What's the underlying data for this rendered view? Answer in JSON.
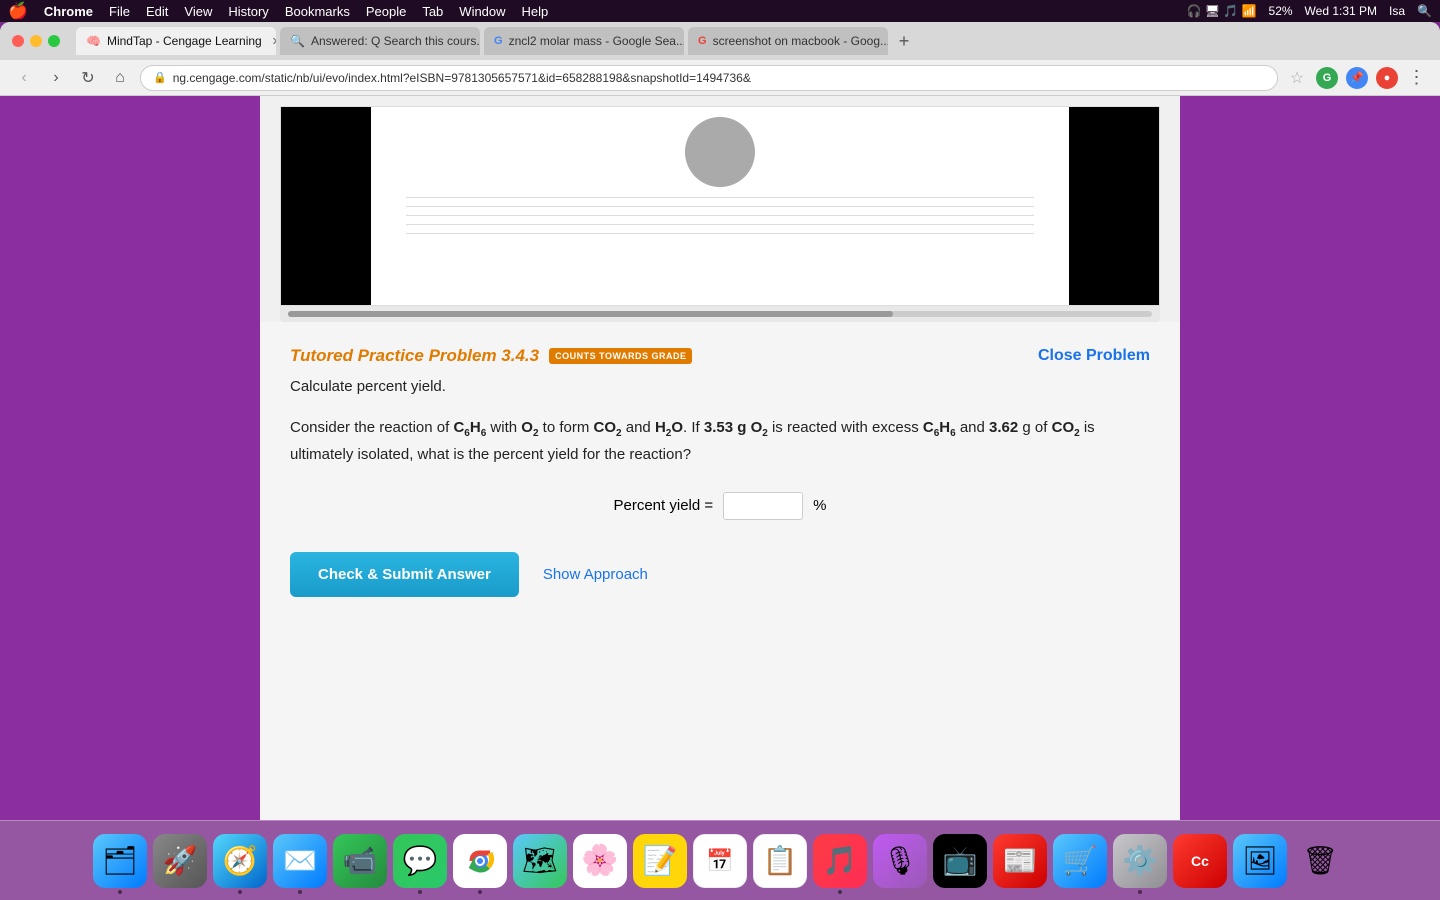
{
  "menubar": {
    "apple": "🍎",
    "items": [
      "Chrome",
      "File",
      "Edit",
      "View",
      "History",
      "Bookmarks",
      "People",
      "Tab",
      "Window",
      "Help"
    ],
    "right": {
      "time": "Wed 1:31 PM",
      "battery": "52%",
      "wifi": "WiFi",
      "user": "Isa"
    }
  },
  "browser": {
    "tabs": [
      {
        "id": "tab1",
        "label": "MindTap - Cengage Learning",
        "active": true,
        "favicon": "🧠"
      },
      {
        "id": "tab2",
        "label": "Answered: Q Search this cours...",
        "active": false,
        "favicon": "🔍"
      },
      {
        "id": "tab3",
        "label": "zncl2 molar mass - Google Sea...",
        "active": false,
        "favicon": "G"
      },
      {
        "id": "tab4",
        "label": "screenshot on macbook - Goog...",
        "active": false,
        "favicon": "G"
      }
    ],
    "url": "ng.cengage.com/static/nb/ui/evo/index.html?eISBN=9781305657571&id=658288198&snapshotId=1494736&"
  },
  "problem": {
    "title": "Tutored Practice Problem 3.4.3",
    "badge": "COUNTS TOWARDS GRADE",
    "close_label": "Close Problem",
    "subtitle": "Calculate percent yield.",
    "body_text": "Consider the reaction of C₆H₆ with O₂ to form CO₂ and H₂O. If 3.53 g O₂ is reacted with excess C₆H₆ and 3.62 g of CO₂ is ultimately isolated, what is the percent yield for the reaction?",
    "answer_label": "Percent yield =",
    "answer_placeholder": "",
    "answer_unit": "%",
    "submit_label": "Check & Submit Answer",
    "approach_label": "Show Approach"
  },
  "dock": {
    "items": [
      {
        "id": "finder",
        "emoji": "🗂",
        "color": "dock-finder"
      },
      {
        "id": "launchpad",
        "emoji": "🚀",
        "color": "dock-launchpad"
      },
      {
        "id": "safari",
        "emoji": "🧭",
        "color": "dock-safari"
      },
      {
        "id": "mail",
        "emoji": "✉️",
        "color": "dock-mail"
      },
      {
        "id": "facetime",
        "emoji": "📹",
        "color": "dock-facetime"
      },
      {
        "id": "messages",
        "emoji": "💬",
        "color": "dock-messages"
      },
      {
        "id": "chrome",
        "emoji": "🌐",
        "color": "dock-chrome"
      },
      {
        "id": "maps",
        "emoji": "🗺",
        "color": "dock-maps"
      },
      {
        "id": "photos",
        "emoji": "🌸",
        "color": "dock-photos"
      },
      {
        "id": "notes",
        "emoji": "📝",
        "color": "dock-notes"
      },
      {
        "id": "calendar",
        "emoji": "📅",
        "color": "dock-calendar"
      },
      {
        "id": "reminders",
        "emoji": "📋",
        "color": "dock-reminders"
      },
      {
        "id": "music",
        "emoji": "🎵",
        "color": "dock-music"
      },
      {
        "id": "podcasts",
        "emoji": "🎙",
        "color": "dock-podcasts"
      },
      {
        "id": "tv",
        "emoji": "📺",
        "color": "dock-tv"
      },
      {
        "id": "news",
        "emoji": "📰",
        "color": "dock-news"
      },
      {
        "id": "appstore",
        "emoji": "🛒",
        "color": "dock-appstore"
      },
      {
        "id": "preferences",
        "emoji": "⚙️",
        "color": "dock-preferences"
      },
      {
        "id": "creative",
        "emoji": "🎨",
        "color": "dock-creative"
      },
      {
        "id": "iphoto",
        "emoji": "🖼",
        "color": "dock-iphoto"
      },
      {
        "id": "trash",
        "emoji": "🗑",
        "color": "dock-trash"
      }
    ]
  }
}
